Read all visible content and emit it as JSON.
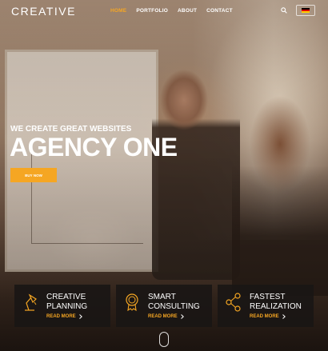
{
  "brand": {
    "logo_text": "CREATIVE"
  },
  "nav": {
    "items": [
      {
        "label": "HOME",
        "active": true
      },
      {
        "label": "PORTFOLIO",
        "active": false
      },
      {
        "label": "ABOUT",
        "active": false
      },
      {
        "label": "CONTACT",
        "active": false
      }
    ]
  },
  "header": {
    "search_icon": "search-icon",
    "language_flag": "germany-flag-icon"
  },
  "hero": {
    "tagline": "WE CREATE GREAT WEBSITES",
    "headline": "AGENCY ONE",
    "button_label": "BUY NOW"
  },
  "features": [
    {
      "icon": "lamp-icon",
      "title_line1": "CREATIVE",
      "title_line2": "PLANNING",
      "link": "READ MORE"
    },
    {
      "icon": "award-ribbon-icon",
      "title_line1": "SMART",
      "title_line2": "CONSULTING",
      "link": "READ MORE"
    },
    {
      "icon": "share-nodes-icon",
      "title_line1": "FASTEST",
      "title_line2": "REALIZATION",
      "link": "READ MORE"
    }
  ],
  "colors": {
    "accent": "#f5a623",
    "card_bg": "#191614",
    "text": "#ffffff"
  }
}
